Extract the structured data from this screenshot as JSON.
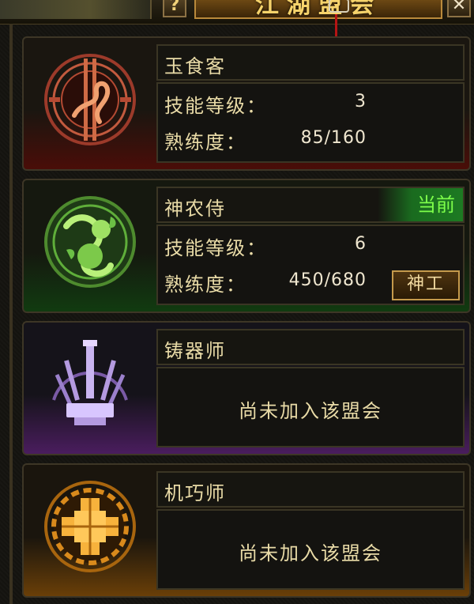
{
  "window": {
    "title": "江湖盟会",
    "help_label": "?",
    "close_label": "✕"
  },
  "guilds": [
    {
      "name": "玉食客",
      "color": "#c0392b",
      "icon": "chef-dragon-emblem-icon",
      "joined": true,
      "level_label": "技能等级：",
      "level": "3",
      "proficiency_label": "熟练度：",
      "proficiency": "85/160"
    },
    {
      "name": "神农侍",
      "color": "#3fa531",
      "icon": "herb-gourd-emblem-icon",
      "joined": true,
      "current_label": "当前",
      "level_label": "技能等级：",
      "level": "6",
      "proficiency_label": "熟练度：",
      "proficiency": "450/680",
      "action_label": "神工"
    },
    {
      "name": "铸器师",
      "color": "#9b59d0",
      "icon": "forge-anvil-emblem-icon",
      "joined": false,
      "status_text": "尚未加入该盟会"
    },
    {
      "name": "机巧师",
      "color": "#e08a14",
      "icon": "gear-puzzle-emblem-icon",
      "joined": false,
      "status_text": "尚未加入该盟会"
    }
  ]
}
